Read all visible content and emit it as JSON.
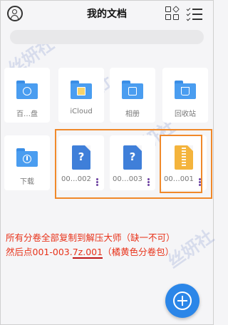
{
  "header": {
    "title": "我的文档",
    "left_icon": "user-circle-icon",
    "right_icons": [
      "grid-view-icon",
      "checklist-icon"
    ]
  },
  "search": {
    "placeholder": ""
  },
  "tiles_row1": [
    {
      "name": "百…盘",
      "icon": "baidu-pan-folder-icon"
    },
    {
      "name": "iCloud",
      "icon": "icloud-folder-icon"
    },
    {
      "name": "相册",
      "icon": "album-folder-icon"
    },
    {
      "name": "回收站",
      "icon": "recycle-bin-folder-icon"
    }
  ],
  "tiles_row2": [
    {
      "name": "下载",
      "icon": "download-folder-icon"
    },
    {
      "name": "00…002",
      "icon": "unknown-file-icon"
    },
    {
      "name": "00…003",
      "icon": "unknown-file-icon"
    },
    {
      "name": "00…001",
      "icon": "zip-file-icon"
    }
  ],
  "unknown_glyph": "?",
  "instruction": {
    "line1": "所有分卷全部复制到解压大师（缺一不可）",
    "line2_prefix": "然后点001-003.",
    "line2_underlined": "7z.001",
    "line2_suffix": "（橘黄色分卷包）"
  },
  "watermark": "丝妍社",
  "colors": {
    "accent_blue": "#2b86e8",
    "highlight_orange": "#f0892a",
    "note_red": "#e8321a",
    "zip_yellow": "#f4b43c"
  }
}
